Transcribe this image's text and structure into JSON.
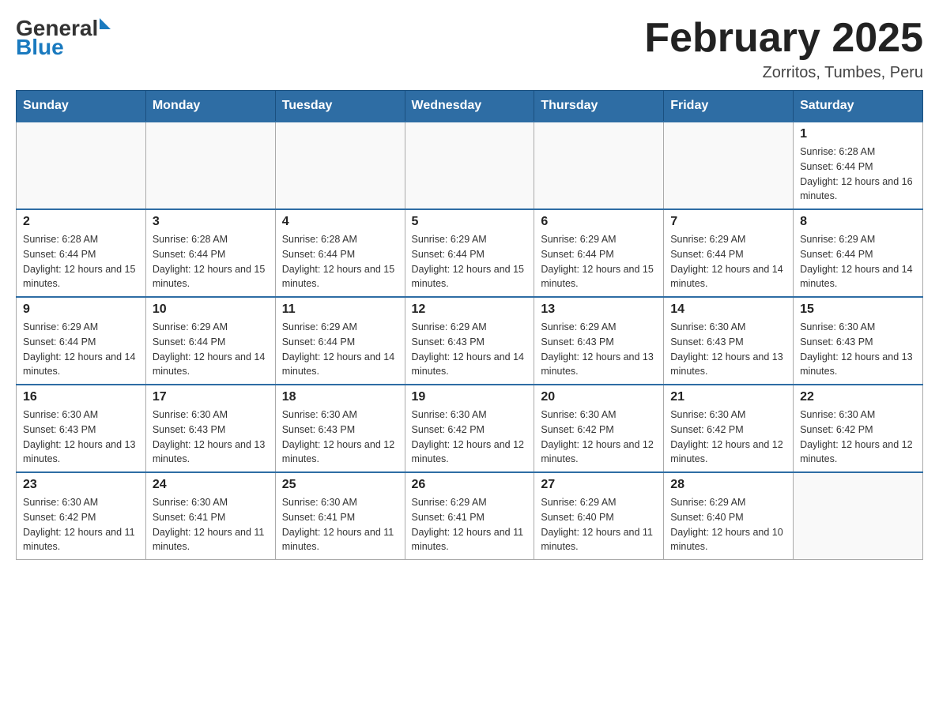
{
  "header": {
    "logo": {
      "general": "General",
      "blue": "Blue",
      "triangle": "▶"
    },
    "title": "February 2025",
    "location": "Zorritos, Tumbes, Peru"
  },
  "calendar": {
    "days_of_week": [
      "Sunday",
      "Monday",
      "Tuesday",
      "Wednesday",
      "Thursday",
      "Friday",
      "Saturday"
    ],
    "weeks": [
      [
        {
          "day": "",
          "info": ""
        },
        {
          "day": "",
          "info": ""
        },
        {
          "day": "",
          "info": ""
        },
        {
          "day": "",
          "info": ""
        },
        {
          "day": "",
          "info": ""
        },
        {
          "day": "",
          "info": ""
        },
        {
          "day": "1",
          "info": "Sunrise: 6:28 AM\nSunset: 6:44 PM\nDaylight: 12 hours and 16 minutes."
        }
      ],
      [
        {
          "day": "2",
          "info": "Sunrise: 6:28 AM\nSunset: 6:44 PM\nDaylight: 12 hours and 15 minutes."
        },
        {
          "day": "3",
          "info": "Sunrise: 6:28 AM\nSunset: 6:44 PM\nDaylight: 12 hours and 15 minutes."
        },
        {
          "day": "4",
          "info": "Sunrise: 6:28 AM\nSunset: 6:44 PM\nDaylight: 12 hours and 15 minutes."
        },
        {
          "day": "5",
          "info": "Sunrise: 6:29 AM\nSunset: 6:44 PM\nDaylight: 12 hours and 15 minutes."
        },
        {
          "day": "6",
          "info": "Sunrise: 6:29 AM\nSunset: 6:44 PM\nDaylight: 12 hours and 15 minutes."
        },
        {
          "day": "7",
          "info": "Sunrise: 6:29 AM\nSunset: 6:44 PM\nDaylight: 12 hours and 14 minutes."
        },
        {
          "day": "8",
          "info": "Sunrise: 6:29 AM\nSunset: 6:44 PM\nDaylight: 12 hours and 14 minutes."
        }
      ],
      [
        {
          "day": "9",
          "info": "Sunrise: 6:29 AM\nSunset: 6:44 PM\nDaylight: 12 hours and 14 minutes."
        },
        {
          "day": "10",
          "info": "Sunrise: 6:29 AM\nSunset: 6:44 PM\nDaylight: 12 hours and 14 minutes."
        },
        {
          "day": "11",
          "info": "Sunrise: 6:29 AM\nSunset: 6:44 PM\nDaylight: 12 hours and 14 minutes."
        },
        {
          "day": "12",
          "info": "Sunrise: 6:29 AM\nSunset: 6:43 PM\nDaylight: 12 hours and 14 minutes."
        },
        {
          "day": "13",
          "info": "Sunrise: 6:29 AM\nSunset: 6:43 PM\nDaylight: 12 hours and 13 minutes."
        },
        {
          "day": "14",
          "info": "Sunrise: 6:30 AM\nSunset: 6:43 PM\nDaylight: 12 hours and 13 minutes."
        },
        {
          "day": "15",
          "info": "Sunrise: 6:30 AM\nSunset: 6:43 PM\nDaylight: 12 hours and 13 minutes."
        }
      ],
      [
        {
          "day": "16",
          "info": "Sunrise: 6:30 AM\nSunset: 6:43 PM\nDaylight: 12 hours and 13 minutes."
        },
        {
          "day": "17",
          "info": "Sunrise: 6:30 AM\nSunset: 6:43 PM\nDaylight: 12 hours and 13 minutes."
        },
        {
          "day": "18",
          "info": "Sunrise: 6:30 AM\nSunset: 6:43 PM\nDaylight: 12 hours and 12 minutes."
        },
        {
          "day": "19",
          "info": "Sunrise: 6:30 AM\nSunset: 6:42 PM\nDaylight: 12 hours and 12 minutes."
        },
        {
          "day": "20",
          "info": "Sunrise: 6:30 AM\nSunset: 6:42 PM\nDaylight: 12 hours and 12 minutes."
        },
        {
          "day": "21",
          "info": "Sunrise: 6:30 AM\nSunset: 6:42 PM\nDaylight: 12 hours and 12 minutes."
        },
        {
          "day": "22",
          "info": "Sunrise: 6:30 AM\nSunset: 6:42 PM\nDaylight: 12 hours and 12 minutes."
        }
      ],
      [
        {
          "day": "23",
          "info": "Sunrise: 6:30 AM\nSunset: 6:42 PM\nDaylight: 12 hours and 11 minutes."
        },
        {
          "day": "24",
          "info": "Sunrise: 6:30 AM\nSunset: 6:41 PM\nDaylight: 12 hours and 11 minutes."
        },
        {
          "day": "25",
          "info": "Sunrise: 6:30 AM\nSunset: 6:41 PM\nDaylight: 12 hours and 11 minutes."
        },
        {
          "day": "26",
          "info": "Sunrise: 6:29 AM\nSunset: 6:41 PM\nDaylight: 12 hours and 11 minutes."
        },
        {
          "day": "27",
          "info": "Sunrise: 6:29 AM\nSunset: 6:40 PM\nDaylight: 12 hours and 11 minutes."
        },
        {
          "day": "28",
          "info": "Sunrise: 6:29 AM\nSunset: 6:40 PM\nDaylight: 12 hours and 10 minutes."
        },
        {
          "day": "",
          "info": ""
        }
      ]
    ]
  }
}
